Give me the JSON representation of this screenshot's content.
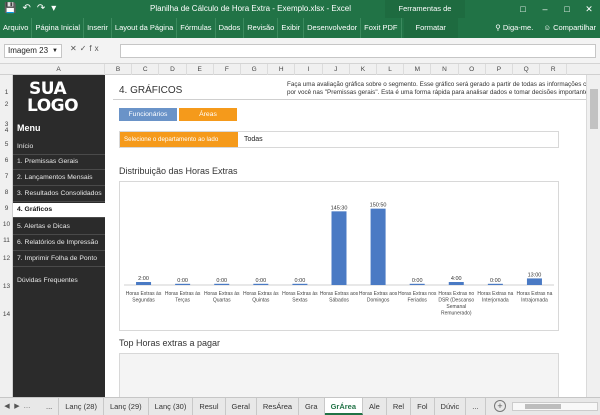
{
  "titlebar": {
    "title": "Planilha de Cálculo de Hora Extra - Exemplo.xlsx - Excel",
    "context_group": "Ferramentas de Imagem",
    "quick_access": [
      "save-icon",
      "undo-icon",
      "redo-icon",
      "customize-icon"
    ]
  },
  "ribbon": {
    "tabs": [
      "Arquivo",
      "Página Inicial",
      "Inserir",
      "Layout da Página",
      "Fórmulas",
      "Dados",
      "Revisão",
      "Exibir",
      "Desenvolvedor",
      "Foxit PDF"
    ],
    "context_tab": "Formatar",
    "tell_me": "Diga-me.",
    "share": "Compartilhar"
  },
  "formula_bar": {
    "name_box": "Imagem 23",
    "fx": "fx",
    "formula": ""
  },
  "columns": [
    "A",
    "B",
    "C",
    "D",
    "E",
    "F",
    "G",
    "H",
    "I",
    "J",
    "K",
    "L",
    "M",
    "N",
    "O",
    "P",
    "Q",
    "R"
  ],
  "rows": [
    "1",
    "2",
    "3",
    "4",
    "5",
    "6",
    "7",
    "8",
    "9",
    "10",
    "11",
    "12",
    "13",
    "14"
  ],
  "sidebar": {
    "logo_line1": "SUA",
    "logo_line2": "LOGO",
    "menu_title": "Menu",
    "items": [
      {
        "label": "Início"
      },
      {
        "label": "1. Premissas Gerais"
      },
      {
        "label": "2. Lançamentos Mensais"
      },
      {
        "label": "3. Resultados Consolidados"
      },
      {
        "label": "4. Gráficos",
        "active": true
      },
      {
        "label": "5. Alertas e Dicas"
      },
      {
        "label": "6. Relatórios de Impressão"
      },
      {
        "label": "7. Imprimir Folha de Ponto"
      },
      {
        "label": "Dúvidas Frequentes"
      }
    ]
  },
  "main": {
    "page_title": "4. GRÁFICOS",
    "description": "Faça uma avaliação gráfica sobre o segmento. Esse gráfico será gerado a partir de todas as informações cedi por você nas \"Premissas gerais\". Esta é uma forma rápida para analisar dados e tomar decisões importantes",
    "btn_funcionarios": "Funcionários",
    "btn_areas": "Áreas",
    "select_label": "Selecione o departamento ao lado",
    "select_value": "Todas",
    "section1_title": "Distribuição das Horas Extras",
    "section2_title": "Top Horas extras a pagar"
  },
  "chart_data": {
    "type": "bar",
    "title": "",
    "categories": [
      "Horas Extras às Segundas",
      "Horas Extras às Terças",
      "Horas Extras às Quartas",
      "Horas Extras às Quintas",
      "Horas Extras às Sextas",
      "Horas Extras aos Sábados",
      "Horas Extras aos Domingos",
      "Horas Extras nos Feriados",
      "Horas Extras no DSR (Descanso Semanal Remunerado)",
      "Horas Extras na Interjornada",
      "Horas Extras na Intrajornada"
    ],
    "labels": [
      "2:00",
      "0:00",
      "0:00",
      "0:00",
      "0:00",
      "145:30",
      "150:50",
      "0:00",
      "4:00",
      "0:00",
      "13:00"
    ],
    "values_hours": [
      2.0,
      0,
      0,
      0,
      0,
      145.5,
      150.83,
      0,
      4.0,
      0,
      13.0
    ],
    "ylim": [
      0,
      160
    ],
    "bar_color": "#4a7ac4"
  },
  "sheet_tabs": {
    "nav": [
      "first-sheet-icon",
      "prev-sheet-icon",
      "more-sheets-icon"
    ],
    "tabs": [
      "...",
      "Lanç (28)",
      "Lanç (29)",
      "Lanç (30)",
      "Resul",
      "Geral",
      "ResÁrea",
      "Gra",
      "GrÁrea",
      "Ale",
      "Rel",
      "Fol",
      "Dúvic",
      "..."
    ],
    "active": "GrÁrea"
  },
  "colors": {
    "excel_green": "#217346",
    "orange": "#f59a1b",
    "blue_button": "#6a93c8",
    "sidebar_bg": "#2b2b2b"
  }
}
